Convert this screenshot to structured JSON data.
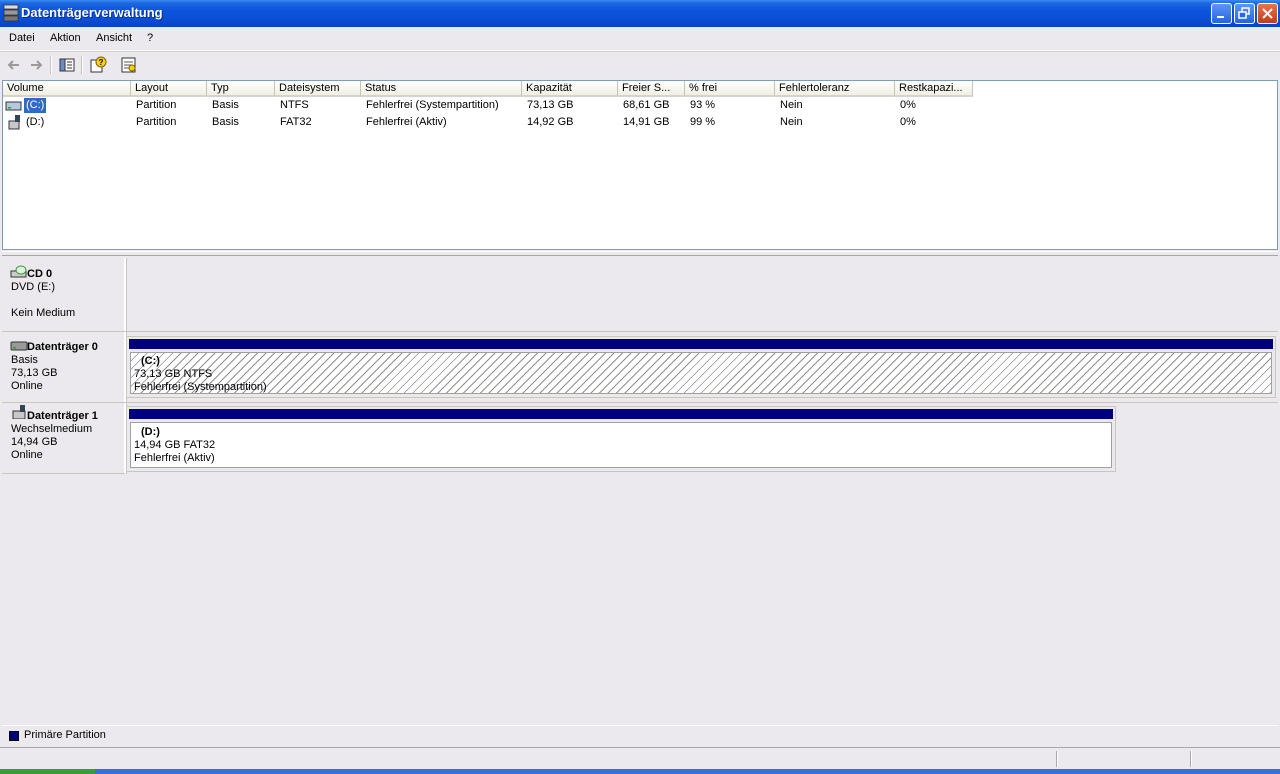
{
  "window": {
    "title": "Datenträgerverwaltung"
  },
  "menu": {
    "items": [
      "Datei",
      "Aktion",
      "Ansicht",
      "?"
    ]
  },
  "volume_list": {
    "columns": [
      "Volume",
      "Layout",
      "Typ",
      "Dateisystem",
      "Status",
      "Kapazität",
      "Freier S...",
      "% frei",
      "Fehlertoleranz",
      "Restkapazi..."
    ],
    "rows": [
      {
        "volume": "(C:)",
        "layout": "Partition",
        "typ": "Basis",
        "dateisystem": "NTFS",
        "status": "Fehlerfrei (Systempartition)",
        "kapazitaet": "73,13 GB",
        "frei": "68,61 GB",
        "prozent": "93 %",
        "fehlertoleranz": "Nein",
        "rest": "0%"
      },
      {
        "volume": "(D:)",
        "layout": "Partition",
        "typ": "Basis",
        "dateisystem": "FAT32",
        "status": "Fehlerfrei (Aktiv)",
        "kapazitaet": "14,92 GB",
        "frei": "14,91 GB",
        "prozent": "99 %",
        "fehlertoleranz": "Nein",
        "rest": "0%"
      }
    ]
  },
  "disks": [
    {
      "name": "CD 0",
      "lines": [
        "DVD (E:)",
        "",
        "Kein Medium"
      ]
    },
    {
      "name": "Datenträger 0",
      "lines": [
        "Basis",
        "73,13 GB",
        "Online"
      ],
      "partition": {
        "title": "(C:)",
        "size": "73,13 GB NTFS",
        "status": "Fehlerfrei (Systempartition)"
      }
    },
    {
      "name": "Datenträger 1",
      "lines": [
        "Wechselmedium",
        "14,94 GB",
        "Online"
      ],
      "partition": {
        "title": "(D:)",
        "size": "14,94 GB FAT32",
        "status": "Fehlerfrei (Aktiv)"
      }
    }
  ],
  "legend": {
    "primary_label": "Primäre Partition",
    "primary_color": "#00007a"
  },
  "colors": {
    "titlebar": "#0a54dd",
    "selection": "#316ac5"
  }
}
